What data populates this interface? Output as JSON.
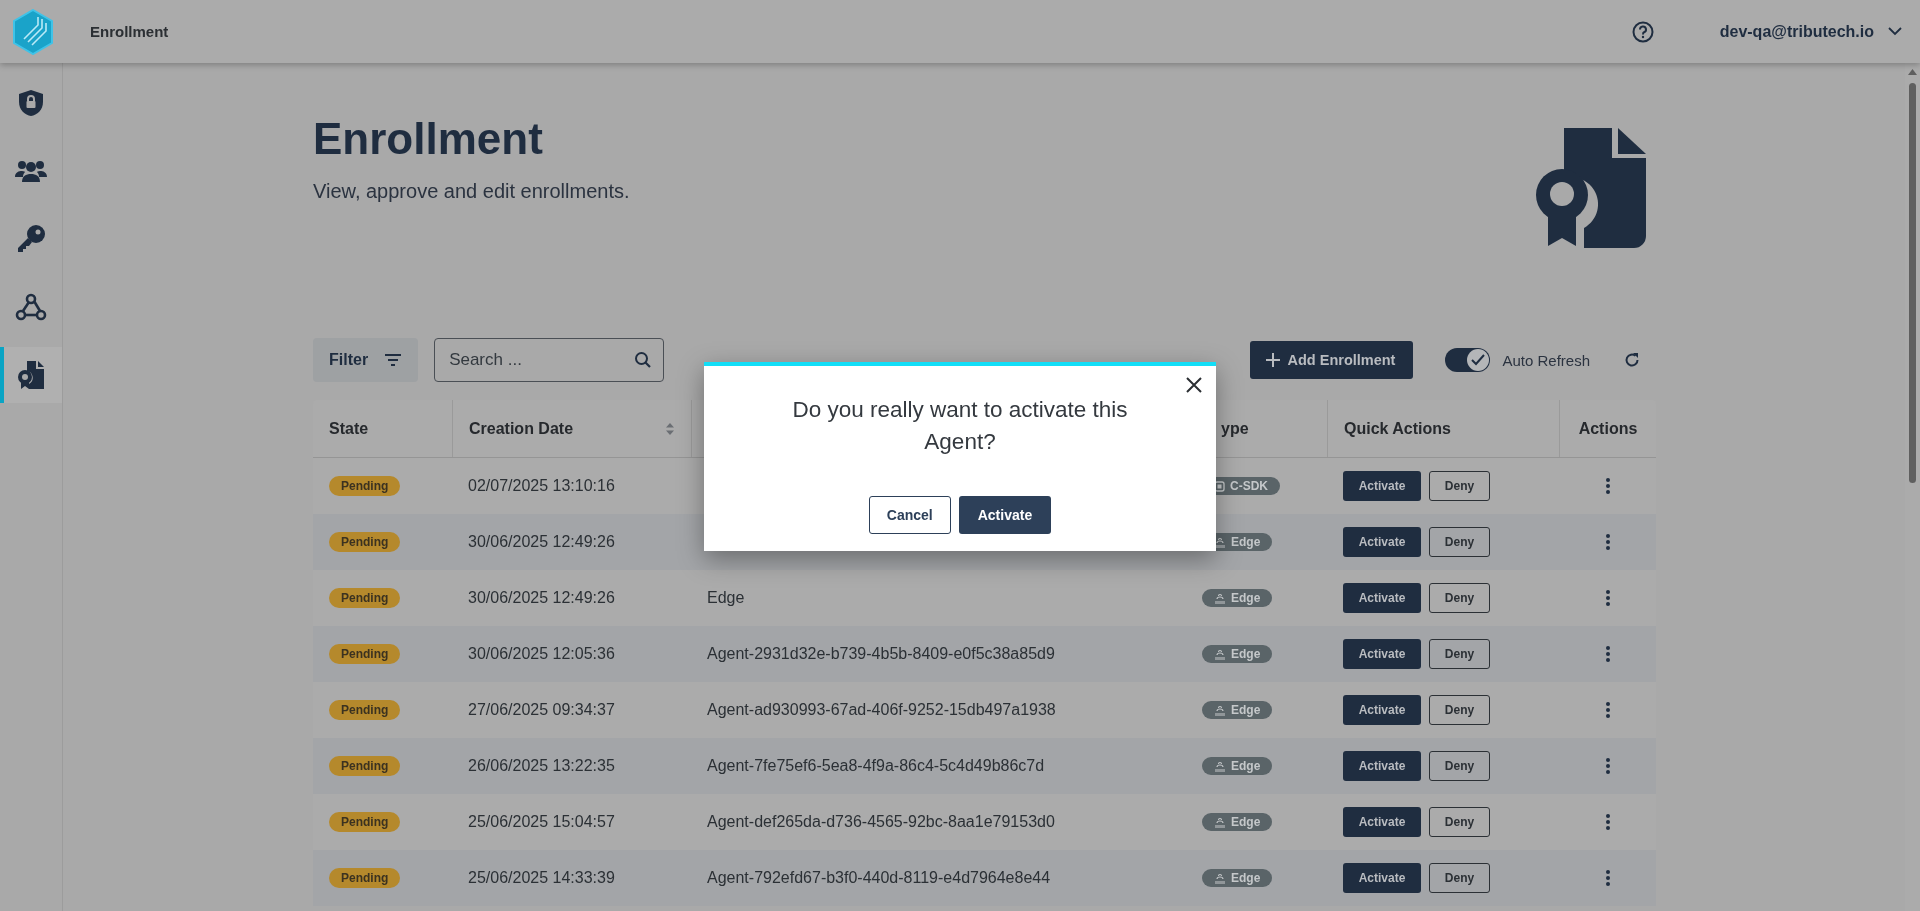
{
  "topbar": {
    "title": "Enrollment",
    "user": "dev-qa@tributech.io"
  },
  "sidebar": {
    "items": [
      {
        "kind": "shield",
        "selected": false
      },
      {
        "kind": "people",
        "selected": false
      },
      {
        "kind": "key",
        "selected": false
      },
      {
        "kind": "webhook",
        "selected": false
      },
      {
        "kind": "certificate",
        "selected": true
      }
    ]
  },
  "page": {
    "title": "Enrollment",
    "subtitle": "View, approve and edit enrollments."
  },
  "toolbar": {
    "filter": "Filter",
    "search": {
      "placeholder": "Search ..."
    },
    "add_button": "Add Enrollment",
    "auto_refresh": {
      "label": "Auto Refresh",
      "on": true
    }
  },
  "table": {
    "columns": [
      {
        "label": "State"
      },
      {
        "label": "Creation Date",
        "sortable": true
      },
      {},
      {
        "label": "ype"
      },
      {
        "label": "Quick Actions"
      },
      {
        "label": "Actions"
      }
    ],
    "rows": [
      {
        "state": "Pending",
        "date": "02/07/2025 13:10:16",
        "type": {
          "kind": "sdk",
          "label": "C-SDK"
        },
        "quick_actions": [
          "Activate",
          "Deny"
        ]
      },
      {
        "state": "Pending",
        "date": "30/06/2025 12:49:26",
        "type": {
          "kind": "edge",
          "label": "Edge"
        },
        "quick_actions": [
          "Activate",
          "Deny"
        ]
      },
      {
        "state": "Pending",
        "date": "30/06/2025 12:49:26",
        "name": "Edge",
        "type": {
          "kind": "edge",
          "label": "Edge"
        },
        "quick_actions": [
          "Activate",
          "Deny"
        ]
      },
      {
        "state": "Pending",
        "date": "30/06/2025 12:05:36",
        "name": "Agent-2931d32e-b739-4b5b-8409-e0f5c38a85d9",
        "type": {
          "kind": "edge",
          "label": "Edge"
        },
        "quick_actions": [
          "Activate",
          "Deny"
        ]
      },
      {
        "state": "Pending",
        "date": "27/06/2025 09:34:37",
        "name": "Agent-ad930993-67ad-406f-9252-15db497a1938",
        "type": {
          "kind": "edge",
          "label": "Edge"
        },
        "quick_actions": [
          "Activate",
          "Deny"
        ]
      },
      {
        "state": "Pending",
        "date": "26/06/2025 13:22:35",
        "name": "Agent-7fe75ef6-5ea8-4f9a-86c4-5c4d49b86c7d",
        "type": {
          "kind": "edge",
          "label": "Edge"
        },
        "quick_actions": [
          "Activate",
          "Deny"
        ]
      },
      {
        "state": "Pending",
        "date": "25/06/2025 15:04:57",
        "name": "Agent-def265da-d736-4565-92bc-8aa1e79153d0",
        "type": {
          "kind": "edge",
          "label": "Edge"
        },
        "quick_actions": [
          "Activate",
          "Deny"
        ]
      },
      {
        "state": "Pending",
        "date": "25/06/2025 14:33:39",
        "name": "Agent-792efd67-b3f0-440d-8119-e4d7964e8e44",
        "type": {
          "kind": "edge",
          "label": "Edge"
        },
        "quick_actions": [
          "Activate",
          "Deny"
        ]
      }
    ]
  },
  "dialog": {
    "message": "Do you really want to activate this Agent?",
    "buttons": [
      {
        "label": "Cancel",
        "kind": "secondary"
      },
      {
        "label": "Activate",
        "kind": "primary"
      }
    ]
  }
}
